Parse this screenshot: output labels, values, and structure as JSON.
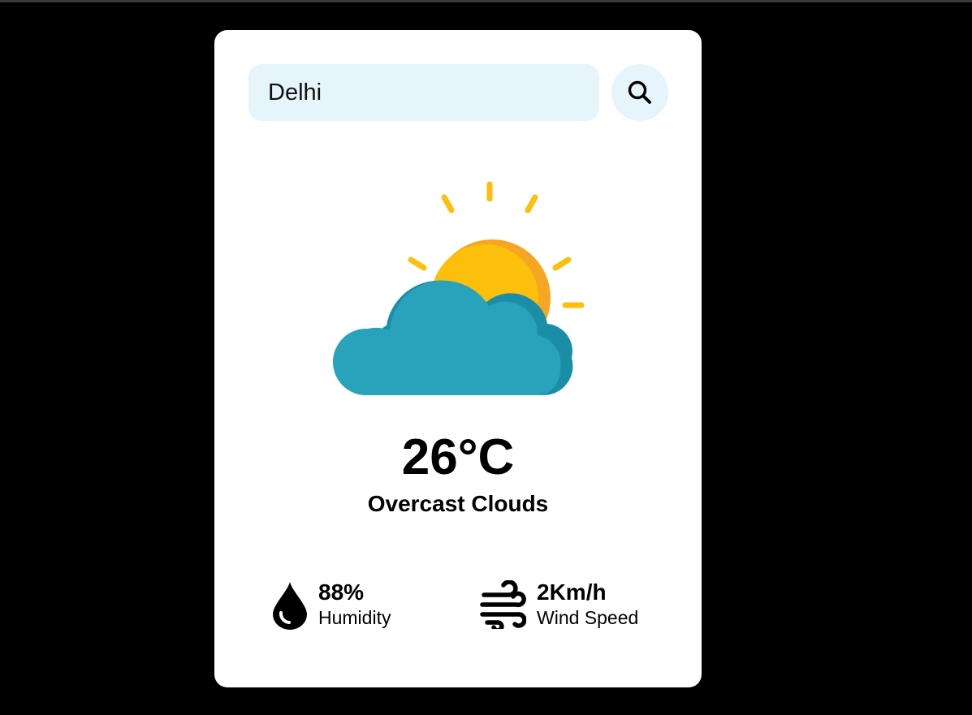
{
  "search": {
    "value": "Delhi",
    "icon": "search-icon"
  },
  "weather": {
    "icon": "partly-cloudy-icon",
    "temperature": "26°C",
    "condition": "Overcast Clouds"
  },
  "details": {
    "humidity": {
      "value": "88%",
      "label": "Humidity",
      "icon": "droplet-icon"
    },
    "wind": {
      "value": "2Km/h",
      "label": "Wind Speed",
      "icon": "wind-icon"
    }
  },
  "colors": {
    "background": "#000000",
    "card": "#ffffff",
    "search_bg": "#e6f4fb",
    "sun": "#fbbf0c",
    "sun_shade": "#f5a623",
    "cloud": "#29a3bb",
    "cloud_shade": "#1a8ea6"
  }
}
